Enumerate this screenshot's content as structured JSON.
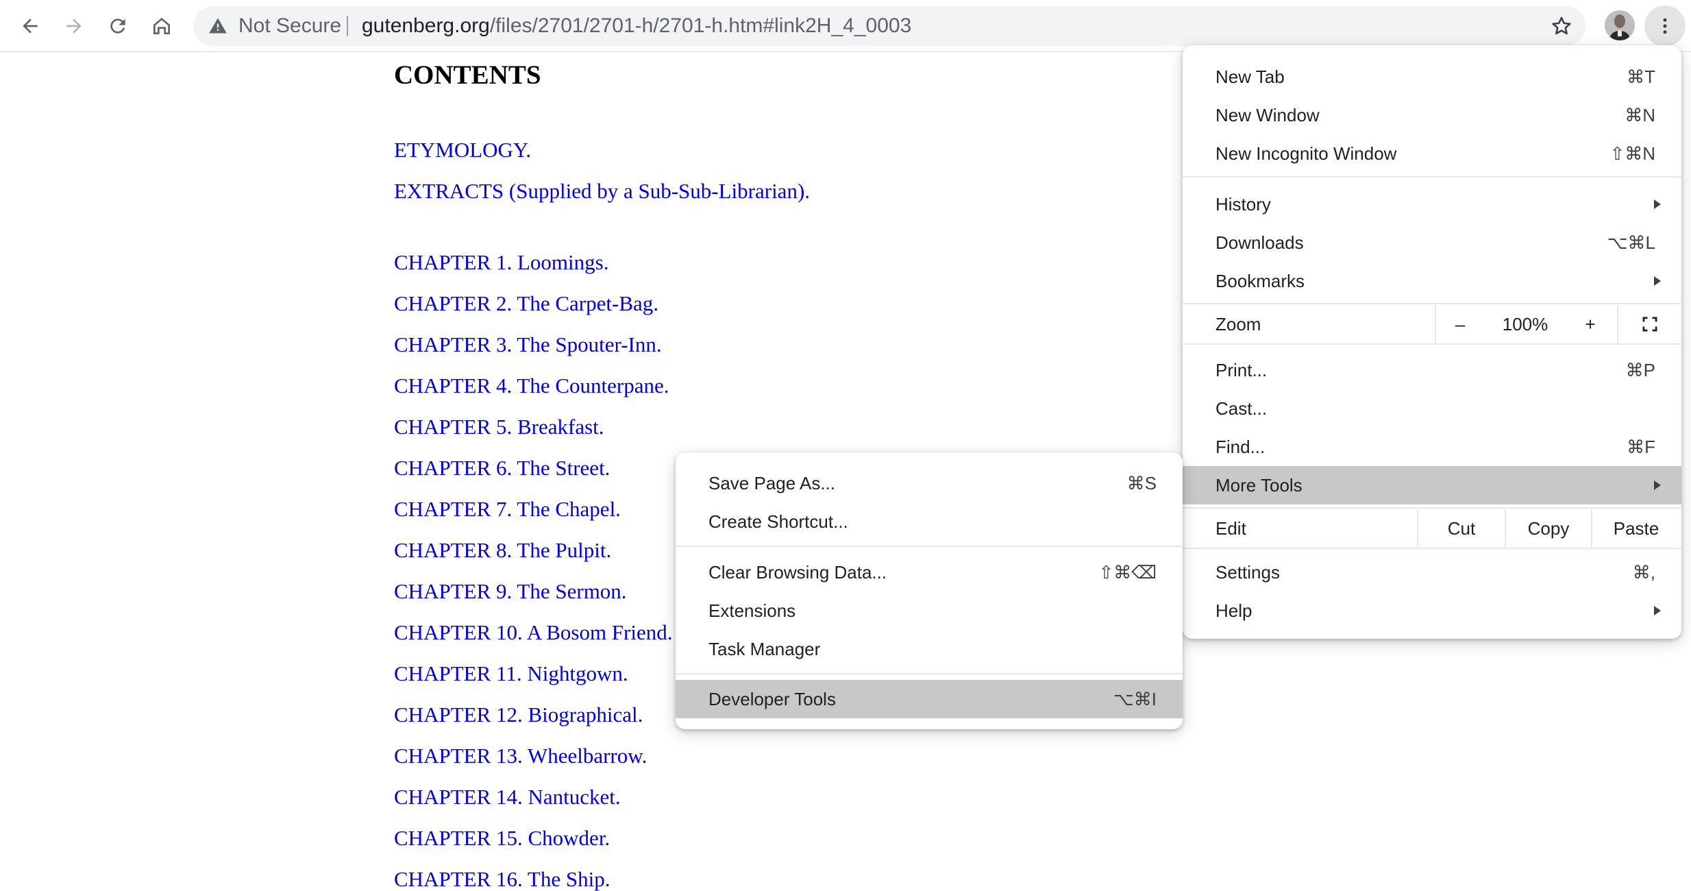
{
  "toolbar": {
    "security_label": "Not Secure",
    "url_host": "gutenberg.org",
    "url_path": "/files/2701/2701-h/2701-h.htm#link2H_4_0003",
    "icons": {
      "back": "arrow-left-icon",
      "forward": "arrow-right-icon",
      "reload": "reload-icon",
      "home": "home-icon",
      "warning": "warning-triangle-icon",
      "bookmark": "star-icon",
      "menu": "vertical-dots-icon"
    }
  },
  "page": {
    "heading": "CONTENTS",
    "links": [
      "ETYMOLOGY.",
      "EXTRACTS (Supplied by a Sub-Sub-Librarian).",
      "CHAPTER 1. Loomings.",
      "CHAPTER 2. The Carpet-Bag.",
      "CHAPTER 3. The Spouter-Inn.",
      "CHAPTER 4. The Counterpane.",
      "CHAPTER 5. Breakfast.",
      "CHAPTER 6. The Street.",
      "CHAPTER 7. The Chapel.",
      "CHAPTER 8. The Pulpit.",
      "CHAPTER 9. The Sermon.",
      "CHAPTER 10. A Bosom Friend.",
      "CHAPTER 11. Nightgown.",
      "CHAPTER 12. Biographical.",
      "CHAPTER 13. Wheelbarrow.",
      "CHAPTER 14. Nantucket.",
      "CHAPTER 15. Chowder.",
      "CHAPTER 16. The Ship."
    ],
    "link_color": "#0000ee"
  },
  "main_menu": {
    "new_tab": "New Tab",
    "new_tab_sc": "⌘T",
    "new_window": "New Window",
    "new_window_sc": "⌘N",
    "new_incognito": "New Incognito Window",
    "new_incognito_sc": "⇧⌘N",
    "history": "History",
    "downloads": "Downloads",
    "downloads_sc": "⌥⌘L",
    "bookmarks": "Bookmarks",
    "zoom": "Zoom",
    "zoom_minus": "–",
    "zoom_value": "100%",
    "zoom_plus": "+",
    "print": "Print...",
    "print_sc": "⌘P",
    "cast": "Cast...",
    "find": "Find...",
    "find_sc": "⌘F",
    "more_tools": "More Tools",
    "edit": "Edit",
    "cut": "Cut",
    "copy": "Copy",
    "paste": "Paste",
    "settings": "Settings",
    "settings_sc": "⌘,",
    "help": "Help"
  },
  "sub_menu": {
    "save_page": "Save Page As...",
    "save_page_sc": "⌘S",
    "create_shortcut": "Create Shortcut...",
    "clear_data": "Clear Browsing Data...",
    "clear_data_sc": "⇧⌘⌫",
    "extensions": "Extensions",
    "task_manager": "Task Manager",
    "dev_tools": "Developer Tools",
    "dev_tools_sc": "⌥⌘I"
  },
  "colors": {
    "highlight": "#c8c8c8",
    "omnibox_bg": "#f1f3f4"
  }
}
